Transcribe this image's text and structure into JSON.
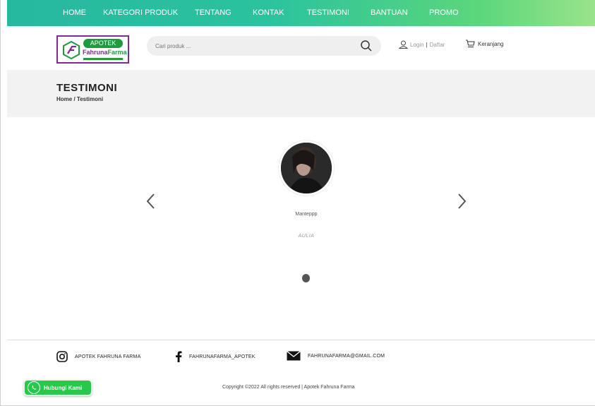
{
  "nav": {
    "items": [
      "HOME",
      "KATEGORI PRODUK",
      "TENTANG",
      "KONTAK",
      "TESTIMONI",
      "BANTUAN",
      "PROMO"
    ]
  },
  "header": {
    "logo": {
      "badge": "APOTEK",
      "brand_part1": "Fahruna",
      "brand_part2": "Farma",
      "icon": "hexagon-logo-icon"
    },
    "search": {
      "placeholder": "Cari produk ...",
      "value": "",
      "icon": "search-icon"
    },
    "login_label": "Login",
    "separator": "|",
    "register_label": "Daftar",
    "cart_label": "Keranjang"
  },
  "page": {
    "title": "TESTIMONI",
    "breadcrumb": "Home / Testimoni"
  },
  "testimonial": {
    "quote": "Manteppp",
    "author": "AULIA",
    "prev_icon": "chevron-left-icon",
    "next_icon": "chevron-right-icon"
  },
  "footer": {
    "instagram": "APOTEK FAHRUNA FARMA",
    "facebook": "FAHRUNAFARMA_APOTEK",
    "email": "FAHRUNAFARMA@GMAIL.COM",
    "copyright": "Copyright ©2022 All rights reserved | Apotek Fahruna Farma"
  },
  "whatsapp": {
    "label": "Hubungi Kami",
    "icon": "whatsapp-icon"
  },
  "colors": {
    "nav_gradient_start": "#27b8a0",
    "nav_gradient_end": "#9be38a",
    "logo_purple": "#7a2f8f",
    "logo_green": "#1f9b3f",
    "whatsapp_green": "#28c84a"
  }
}
